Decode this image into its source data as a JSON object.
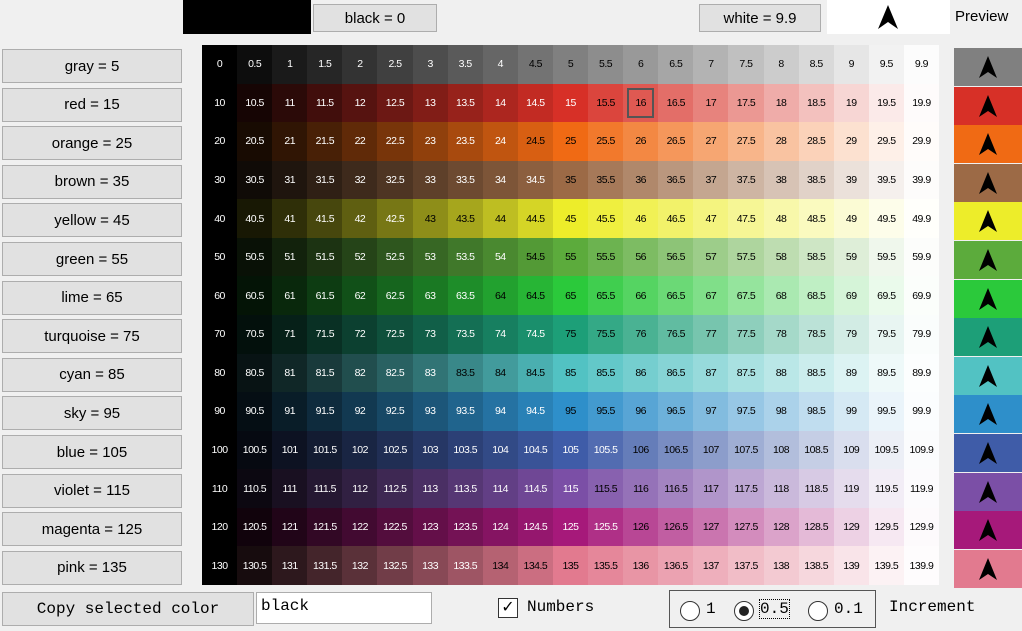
{
  "header": {
    "black_label": "black = 0",
    "white_label": "white = 9.9",
    "preview_label": "Preview"
  },
  "color_buttons": [
    {
      "label": "gray = 5",
      "color": "#808080"
    },
    {
      "label": "red = 15",
      "color": "#d73027"
    },
    {
      "label": "orange = 25",
      "color": "#f06a14"
    },
    {
      "label": "brown = 35",
      "color": "#9c6a46"
    },
    {
      "label": "yellow = 45",
      "color": "#eded2a"
    },
    {
      "label": "green = 55",
      "color": "#5cab3c"
    },
    {
      "label": "lime = 65",
      "color": "#2bc93b"
    },
    {
      "label": "turquoise = 75",
      "color": "#1d9f78"
    },
    {
      "label": "cyan = 85",
      "color": "#52c2c3"
    },
    {
      "label": "sky = 95",
      "color": "#2e8fca"
    },
    {
      "label": "blue = 105",
      "color": "#3f5ca8"
    },
    {
      "label": "violet = 115",
      "color": "#7b4fa6"
    },
    {
      "label": "magenta = 125",
      "color": "#a6197a"
    },
    {
      "label": "pink = 135",
      "color": "#e27a8f"
    }
  ],
  "grid": {
    "rows": [
      0,
      10,
      20,
      30,
      40,
      50,
      60,
      70,
      80,
      90,
      100,
      110,
      120,
      130
    ],
    "steps": [
      "0",
      "0.5",
      "1",
      "1.5",
      "2",
      "2.5",
      "3",
      "3.5",
      "4",
      "4.5",
      "5",
      "5.5",
      "6",
      "6.5",
      "7",
      "7.5",
      "8",
      "8.5",
      "9",
      "9.5",
      "9.9"
    ],
    "selected_value": "16"
  },
  "footer": {
    "copy_button": "Copy selected color",
    "color_value": "black",
    "numbers_label": "Numbers",
    "numbers_checked": true,
    "increment_options": [
      "1",
      "0.5",
      "0.1"
    ],
    "increment_selected": "0.5",
    "increment_label": "Increment"
  }
}
